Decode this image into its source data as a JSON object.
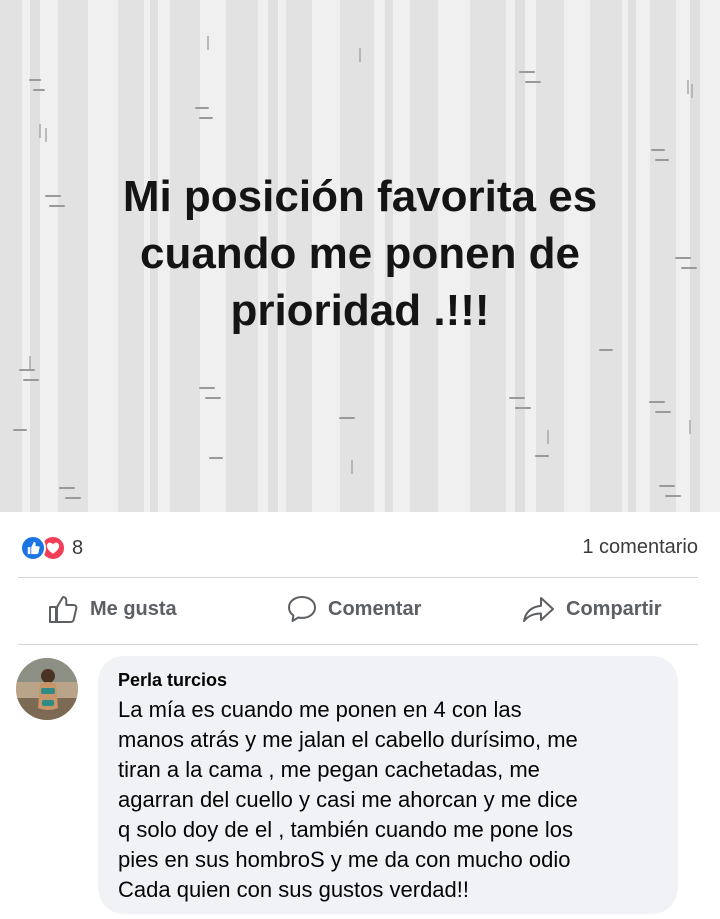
{
  "post": {
    "text_lines": [
      "Mi posición favorita es",
      "cuando me ponen de",
      "prioridad .!!!"
    ],
    "background_style": "birch forest pattern, light gray"
  },
  "reactions": {
    "icons": [
      "like-icon",
      "love-icon"
    ],
    "count": "8",
    "comment_count_label": "1 comentario"
  },
  "actions": {
    "like_label": "Me gusta",
    "comment_label": "Comentar",
    "share_label": "Compartir"
  },
  "comment": {
    "author": "Perla turcios",
    "lines": [
      "La mía es cuando me ponen en 4 con las",
      "manos atrás y me jalan el cabello durísimo, me",
      "tiran a la cama , me pegan cachetadas, me",
      "agarran del cuello y casi me ahorcan y me dice",
      "q solo doy de el , también cuando me pone los",
      "pies en sus hombroS y me da con mucho odio",
      "Cada quien con sus gustos verdad!!"
    ]
  },
  "colors": {
    "like_blue": "#1b74e4",
    "love_red": "#f33e58",
    "action_gray": "#5c5f63",
    "comment_bubble": "#f0f2f5",
    "post_bg": "#f0f0f0"
  }
}
